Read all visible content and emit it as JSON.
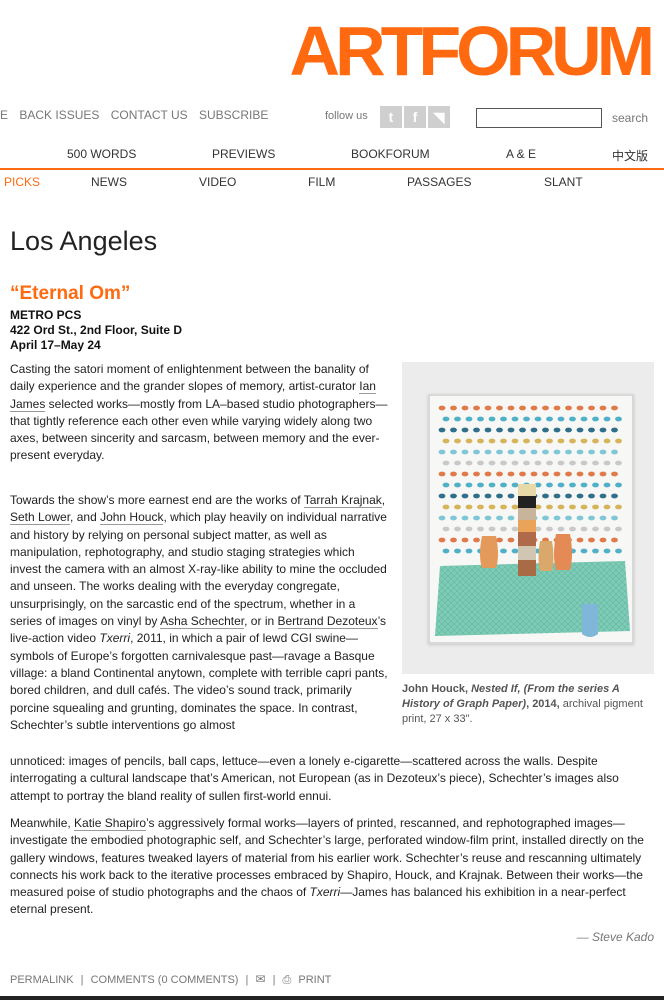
{
  "logo": "ARTFORUM",
  "topnav": [
    "E",
    "BACK ISSUES",
    "CONTACT US",
    "SUBSCRIBE"
  ],
  "follow_text": "follow us",
  "social": [
    {
      "icon": "twitter-icon",
      "glyph": "t"
    },
    {
      "icon": "facebook-icon",
      "glyph": "f"
    },
    {
      "icon": "rss-icon",
      "glyph": "◥"
    }
  ],
  "search": {
    "value": "",
    "button": "search"
  },
  "nav2": [
    "500 WORDS",
    "PREVIEWS",
    "BOOKFORUM",
    "A & E",
    "中文版"
  ],
  "nav3": [
    "PICKS",
    "NEWS",
    "VIDEO",
    "FILM",
    "PASSAGES",
    "SLANT"
  ],
  "accent_color": "#ff6a10",
  "article": {
    "city": "Los Angeles",
    "title": "“Eternal Om”",
    "venue": "METRO PCS",
    "address": "422 Ord St., 2nd Floor, Suite D",
    "dates": "April 17–May 24",
    "p1": {
      "a": "Casting the satori moment of enlightenment between the banality of daily experience and the grander slopes of memory, artist-curator ",
      "link": "Ian James",
      "b": " selected works—mostly from LA–based studio photographers—that tightly reference each other even while varying widely along two axes, between sincerity and sarcasm, between memory and the ever-present everyday."
    },
    "p2": {
      "a": "Towards the show’s more earnest end are the works of ",
      "l1": "Tarrah Krajnak",
      "s1": ", ",
      "l2": "Seth Lower",
      "s2": ", and ",
      "l3": "John Houck",
      "b": ", which play heavily on individual narrative and history by relying on personal subject matter, as well as manipulation, rephotography, and studio staging strategies which invest the camera with an almost X-ray-like ability to mine the occluded and unseen. The works dealing with the everyday congregate, unsurprisingly, on the sarcastic end of the spectrum, whether in a series of images on vinyl by ",
      "l4": "Asha Schechter",
      "c": ", or in ",
      "l5": "Bertrand Dezoteux",
      "d": "’s live-action video ",
      "title": "Txerri",
      "e": ", 2011, in which a pair of lewd CGI swine—symbols of Europe’s forgotten carnivalesque past—ravage a Basque village: a bland Continental anytown, complete with terrible capri pants, bored children, and dull cafés. The video’s sound track, primarily porcine squealing and grunting, dominates the space. In contrast, Schechter’s subtle interventions go almost",
      "f": "unnoticed: images of pencils, ball caps, lettuce—even a lonely e-cigarette—scattered across the walls. Despite interrogating a cultural landscape that’s American, not European (as in Dezoteux’s piece), Schechter’s images also attempt to portray the bland reality of sullen first-world ennui."
    },
    "p3": {
      "a": "Meanwhile, ",
      "link": "Katie Shapiro",
      "b": "’s aggressively formal works—layers of printed, rescanned, and rephotographed images—investigate the embodied photographic self, and Schechter’s large, perforated window-film print, installed directly on the gallery windows, features tweaked layers of material from his earlier work. Schechter’s reuse and rescanning ultimately connects his work back to the iterative processes embraced by Shapiro, Houck, and Krajnak. Between their works—the measured poise of studio photographs and the chaos of ",
      "title": "Txerri",
      "c": "—James has balanced his exhibition in a near-perfect eternal present."
    },
    "caption": {
      "artist": "John Houck, ",
      "work": "Nested If, (From the series A History of Graph Paper)",
      "year": ", 2014,",
      "detail": " archival pigment print, 27 x 33\"."
    },
    "signature": "— Steve Kado"
  },
  "footer": {
    "permalink": "PERMALINK",
    "sep": "|",
    "comments": "COMMENTS (0 COMMENTS)",
    "email_icon": "email-icon",
    "print_icon": "print-icon",
    "print": "PRINT"
  }
}
